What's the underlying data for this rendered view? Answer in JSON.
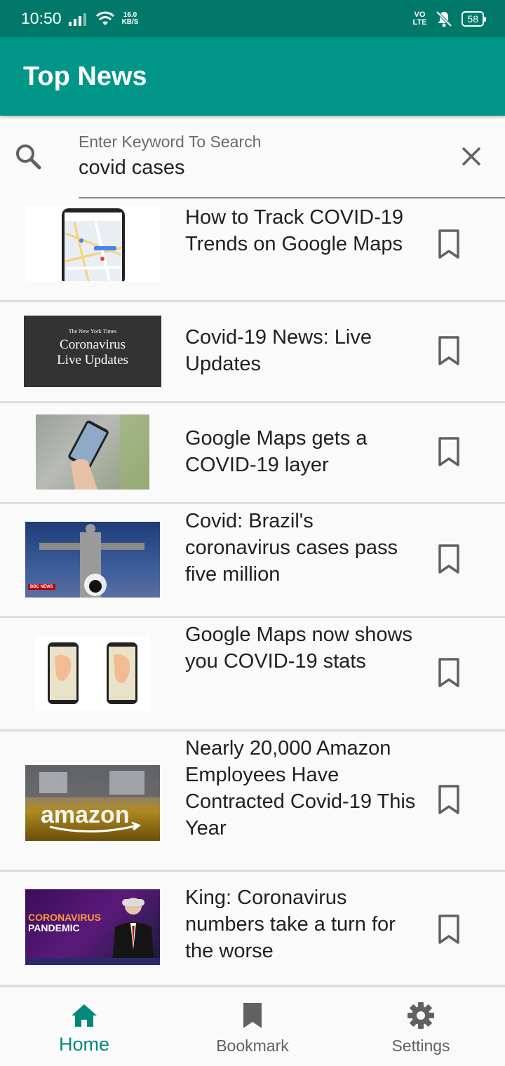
{
  "status_bar": {
    "time": "10:50",
    "net_speed_value": "16.0",
    "net_speed_unit": "KB/S",
    "volte_top": "VO",
    "volte_bottom": "LTE",
    "battery": "58"
  },
  "app_bar": {
    "title": "Top News"
  },
  "search": {
    "placeholder": "Enter Keyword To Search",
    "value": "covid cases"
  },
  "news": [
    {
      "title": "How to Track COVID-19 Trends on Google Maps",
      "thumb": "phone with google maps"
    },
    {
      "title": "Covid-19 News: Live Updates",
      "thumb": "The New York Times banner",
      "thumb_masthead": "The New York Times",
      "thumb_text_1": "Coronavirus",
      "thumb_text_2": "Live Updates"
    },
    {
      "title": "Google Maps gets a COVID-19 layer",
      "thumb": "hand holding phone"
    },
    {
      "title": "Covid: Brazil's coronavirus cases pass five million",
      "thumb": "Christ the Redeemer statue",
      "thumb_badge": "BBC NEWS"
    },
    {
      "title": "Google Maps now shows you COVID-19 stats",
      "thumb": "two phones with maps"
    },
    {
      "title": "Nearly 20,000 Amazon Employees Have Contracted Covid-19 This Year",
      "thumb": "amazon warehouse",
      "thumb_logo": "amazon"
    },
    {
      "title": "King: Coronavirus numbers take a turn for the worse",
      "thumb": "news anchor",
      "thumb_text_1": "CORONAVIRUS",
      "thumb_text_2": "PANDEMIC"
    }
  ],
  "bottom_nav": {
    "home": "Home",
    "bookmark": "Bookmark",
    "settings": "Settings"
  },
  "colors": {
    "primary": "#009688",
    "primary_dark": "#00796b",
    "active": "#00897b",
    "inactive": "#616161"
  }
}
